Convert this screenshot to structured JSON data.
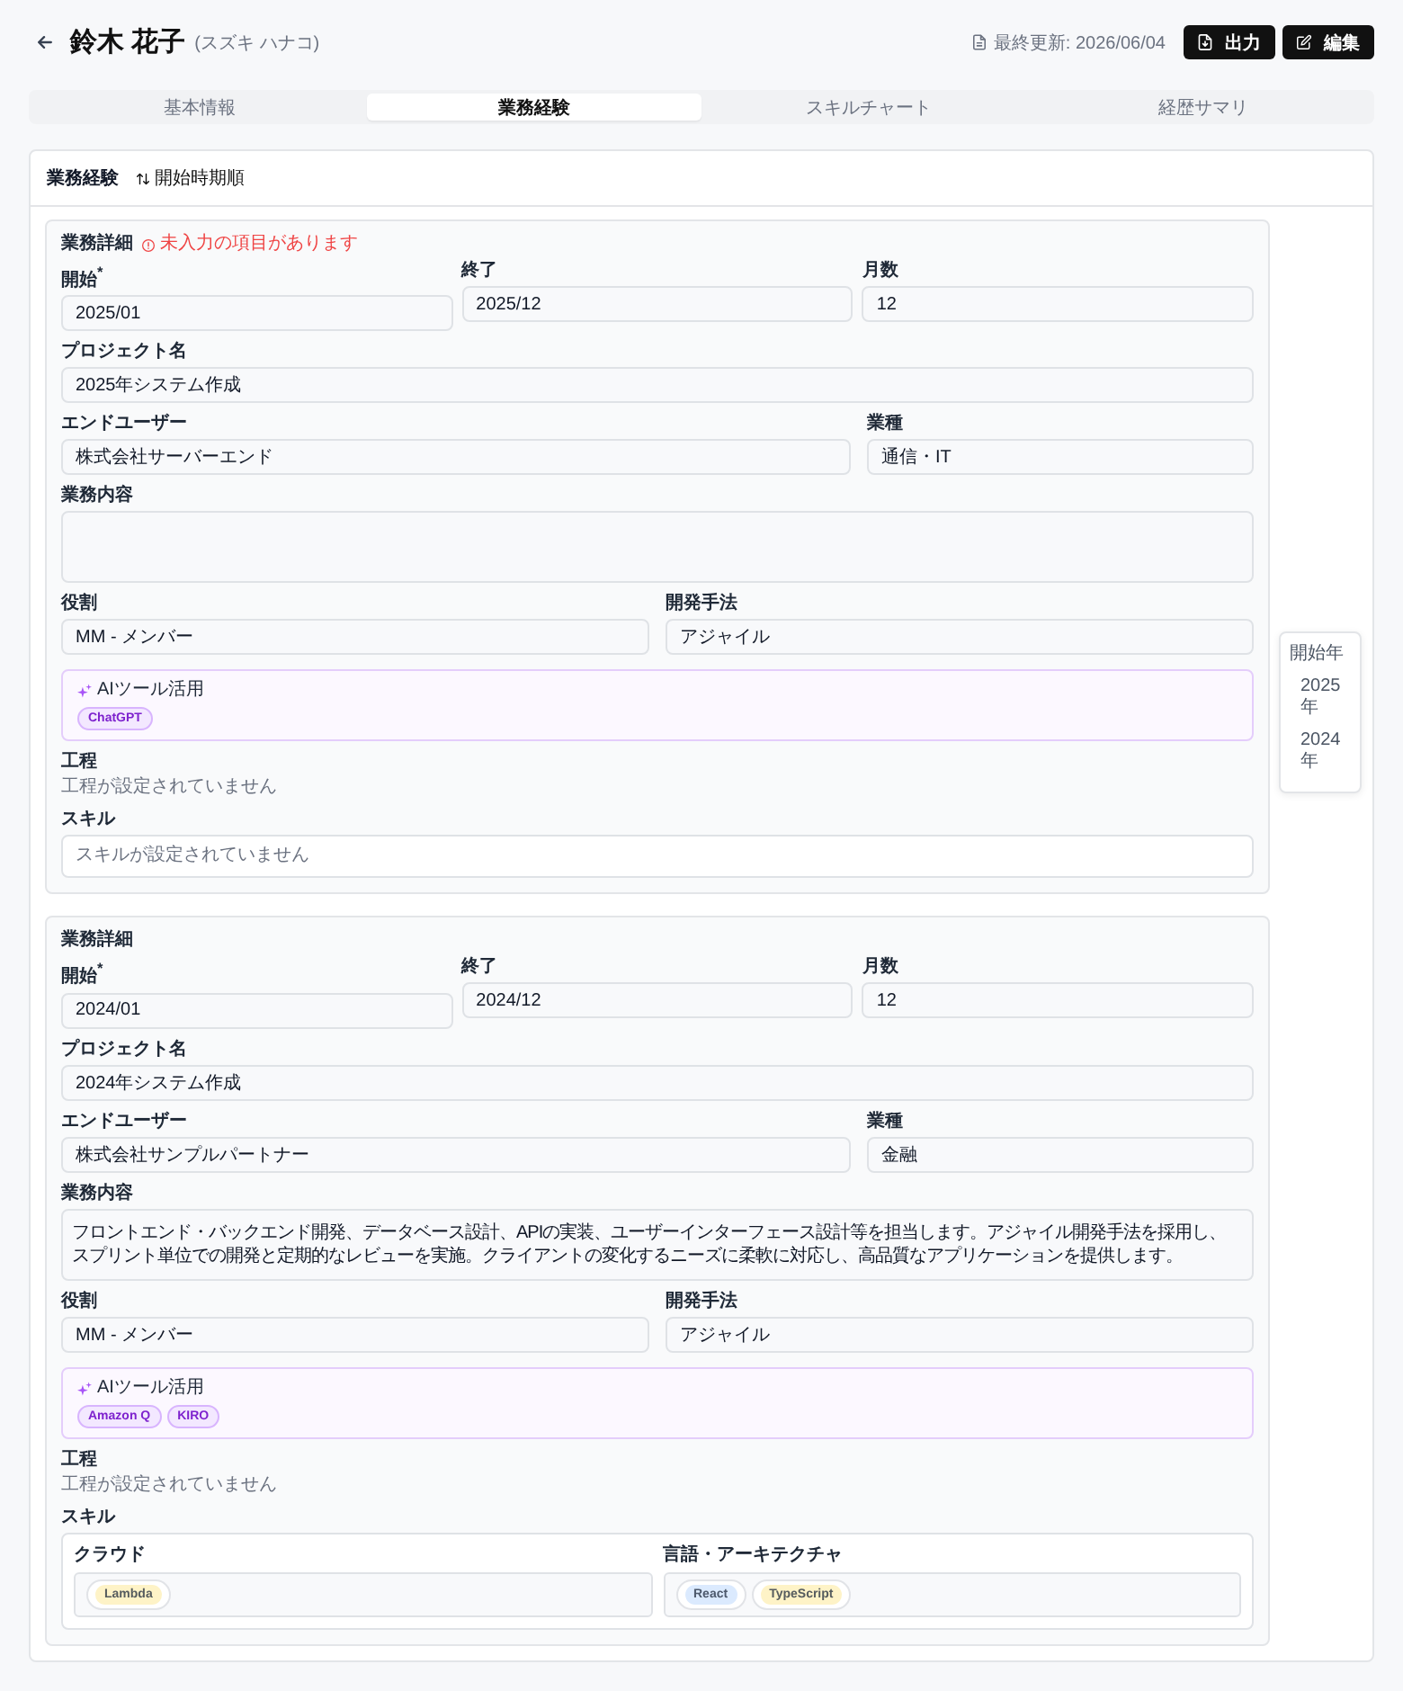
{
  "header": {
    "name": "鈴木 花子",
    "kana": "(スズキ ハナコ)",
    "updated": "最終更新: 2026/06/04",
    "buttons": [
      {
        "kind": "export",
        "label": "出力"
      },
      {
        "kind": "edit",
        "label": "編集"
      }
    ]
  },
  "tabs": [
    {
      "label": "基本情報",
      "selected": false
    },
    {
      "label": "業務経験",
      "selected": true
    },
    {
      "label": "スキルチャート",
      "selected": false
    },
    {
      "label": "経歴サマリ",
      "selected": false
    }
  ],
  "section": {
    "title": "業務経験",
    "sort": "開始時期順"
  },
  "entries": [
    {
      "title": "業務詳細",
      "warning": "未入力の項目があります",
      "period": [
        {
          "label": "開始$^{*}$",
          "value": "2025/01"
        },
        {
          "label": "終了",
          "value": "2025/12"
        },
        {
          "label": "月数",
          "value": "12"
        }
      ],
      "project": {
        "label": "プロジェクト名",
        "value": "2025年システム作成"
      },
      "client": [
        {
          "label": "エンドユーザー",
          "value": "株式会社サーバーエンド"
        },
        {
          "label": "業種",
          "value": "通信・IT"
        }
      ],
      "description": {
        "label": "業務内容"
      },
      "role": [
        {
          "label": "役割",
          "value": "MM - メンバー"
        },
        {
          "label": "開発手法",
          "value": "アジャイル"
        }
      ],
      "ai_tools": {
        "label": "AIツール活用",
        "tools": [
          "ChatGPT"
        ]
      },
      "process": {
        "label": "工程",
        "empty_text": "工程が設定されていません"
      },
      "skills": {
        "label": "スキル",
        "empty_text": "スキルが設定されていません"
      }
    },
    {
      "title": "業務詳細",
      "period": [
        {
          "label": "開始$^{*}$",
          "value": "2024/01"
        },
        {
          "label": "終了",
          "value": "2024/12"
        },
        {
          "label": "月数",
          "value": "12"
        }
      ],
      "project": {
        "label": "プロジェクト名",
        "value": "2024年システム作成"
      },
      "client": [
        {
          "label": "エンドユーザー",
          "value": "株式会社サンプルパートナー"
        },
        {
          "label": "業種",
          "value": "金融"
        }
      ],
      "description": {
        "label": "業務内容",
        "value": "フロントエンド・バックエンド開発、データベース設計、APIの実装、ユーザーインターフェース設計等を担当します。アジャイル開発手法を採用し、スプリント単位での開発と定期的なレビューを実施。クライアントの変化するニーズに柔軟に対応し、高品質なアプリケーションを提供します。"
      },
      "role": [
        {
          "label": "役割",
          "value": "MM - メンバー"
        },
        {
          "label": "開発手法",
          "value": "アジャイル"
        }
      ],
      "ai_tools": {
        "label": "AIツール活用",
        "tools": [
          "Amazon Q",
          "KIRO"
        ]
      },
      "process": {
        "label": "工程",
        "empty_text": "工程が設定されていません"
      },
      "skills": {
        "label": "スキル",
        "groups": [
          {
            "name": "クラウド",
            "items": [
              {
                "label": "Lambda",
                "color": "#fef3c7"
              }
            ]
          },
          {
            "name": "言語・アーキテクチャ",
            "items": [
              {
                "label": "React",
                "color": "#dbeafe"
              },
              {
                "label": "TypeScript",
                "color": "#fef3c7"
              }
            ]
          }
        ]
      }
    }
  ],
  "year_nav": {
    "title": "開始年",
    "items": [
      "2025年",
      "2024年"
    ]
  }
}
